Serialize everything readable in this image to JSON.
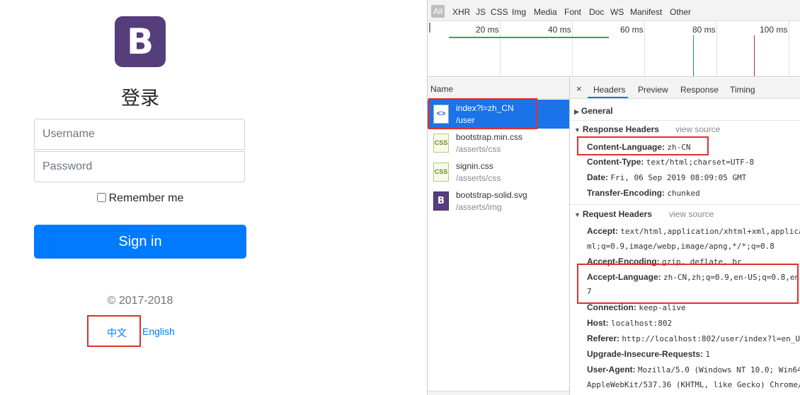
{
  "login": {
    "logo_letter": "B",
    "title": "登录",
    "username_placeholder": "Username",
    "password_placeholder": "Password",
    "remember_label": "Remember me",
    "signin_label": "Sign in",
    "copyright": "© 2017-2018",
    "lang_zh": "中文",
    "lang_en": "English"
  },
  "devtools": {
    "filters": [
      "All",
      "XHR",
      "JS",
      "CSS",
      "Img",
      "Media",
      "Font",
      "Doc",
      "WS",
      "Manifest",
      "Other"
    ],
    "timeline_ticks": [
      "20 ms",
      "40 ms",
      "60 ms",
      "80 ms",
      "100 ms"
    ],
    "name_column": "Name",
    "requests": [
      {
        "name": "index?l=zh_CN",
        "path": "/user",
        "icon": "document-icon"
      },
      {
        "name": "bootstrap.min.css",
        "path": "/asserts/css",
        "icon": "css-file-icon"
      },
      {
        "name": "signin.css",
        "path": "/asserts/css",
        "icon": "css-file-icon"
      },
      {
        "name": "bootstrap-solid.svg",
        "path": "/asserts/img",
        "icon": "svg-image-icon"
      }
    ],
    "tabs": [
      "Headers",
      "Preview",
      "Response",
      "Timing"
    ],
    "close_glyph": "×",
    "sections": {
      "general": "General",
      "response": "Response Headers",
      "request": "Request Headers",
      "view_source": "view source"
    },
    "response_headers": [
      {
        "k": "Content-Language:",
        "v": "zh-CN"
      },
      {
        "k": "Content-Type:",
        "v": "text/html;charset=UTF-8"
      },
      {
        "k": "Date:",
        "v": "Fri, 06 Sep 2019 08:09:05 GMT"
      },
      {
        "k": "Transfer-Encoding:",
        "v": "chunked"
      }
    ],
    "request_headers": {
      "accept_k": "Accept:",
      "accept_v": "text/html,application/xhtml+xml,applica",
      "accept_cont": "ml;q=0.9,image/webp,image/apng,*/*;q=0.8",
      "encoding_k": "Accept-Encoding:",
      "encoding_v": "gzip, deflate, br",
      "language_k": "Accept-Language:",
      "language_v": "zh-CN,zh;q=0.9,en-US;q=0.8,en",
      "language_cont": "7",
      "connection_k": "Connection:",
      "connection_v": "keep-alive",
      "host_k": "Host:",
      "host_v": "localhost:802",
      "referer_k": "Referer:",
      "referer_v": "http://localhost:802/user/index?l=en_U",
      "upgrade_k": "Upgrade-Insecure-Requests:",
      "upgrade_v": "1",
      "ua_k": "User-Agent:",
      "ua_v": "Mozilla/5.0 (Windows NT 10.0; Win64",
      "ua_cont": "AppleWebKit/537.36 (KHTML, like Gecko) Chrome/"
    },
    "colors": {
      "selected_row": "#1a73e8",
      "annotation_red": "#e0302e",
      "bar_green": "#2aa860",
      "bar_teal": "#1a8a8a",
      "bar_red": "#a33"
    }
  }
}
